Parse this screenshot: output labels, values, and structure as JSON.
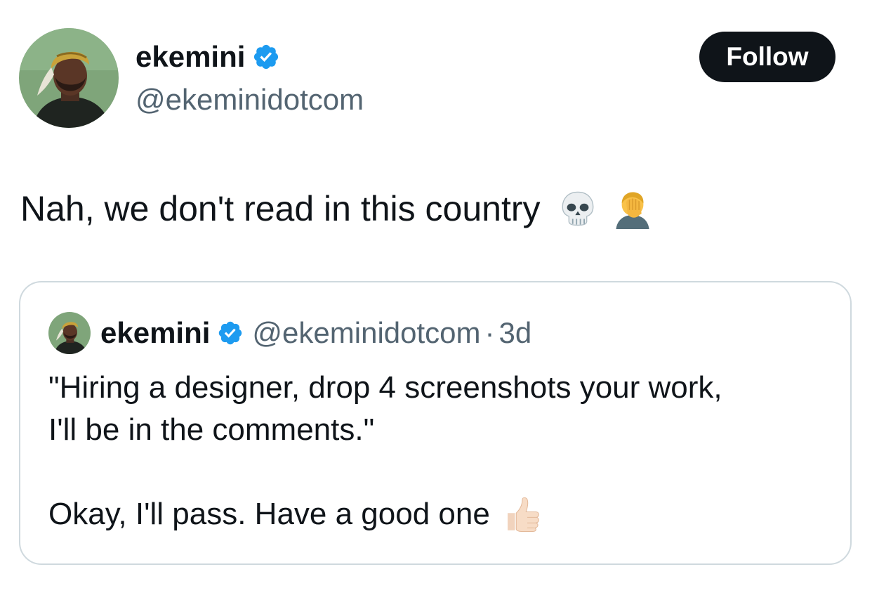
{
  "author": {
    "display_name": "ekemini",
    "handle": "@ekeminidotcom",
    "verified_icon": "verified-badge-icon",
    "avatar": "profile-photo"
  },
  "follow_button": {
    "label": "Follow"
  },
  "tweet": {
    "text": "Nah, we don't read in this country",
    "emojis": [
      "skull-emoji",
      "facepalm-emoji"
    ]
  },
  "quoted_tweet": {
    "display_name": "ekemini",
    "handle": "@ekeminidotcom",
    "separator": "·",
    "time": "3d",
    "lines": [
      "\"Hiring a designer, drop 4 screenshots your work,",
      "I'll be in the comments.\"",
      "Okay, I'll pass. Have a good one"
    ],
    "emoji": "thumbs-up-emoji"
  },
  "colors": {
    "text": "#0f1419",
    "secondary_text": "#536471",
    "verified_blue": "#1d9bf0",
    "follow_button_bg": "#0f1419",
    "card_border": "#cfd9de"
  }
}
